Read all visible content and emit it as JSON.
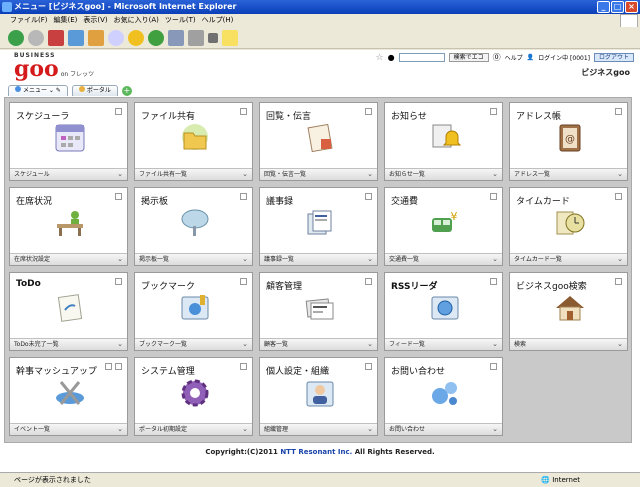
{
  "window": {
    "title": "メニュー [ビジネスgoo] - Microsoft Internet Explorer"
  },
  "menubar": [
    "ファイル(F)",
    "編集(E)",
    "表示(V)",
    "お気に入り(A)",
    "ツール(T)",
    "ヘルプ(H)"
  ],
  "header": {
    "logo_business": "BUSINESS",
    "logo_goo": "goo",
    "logo_sub": "on フレッツ",
    "search_button": "検索でエコ",
    "help": "ヘルプ",
    "login_status": "ログイン中 [0001]",
    "logout": "ログアウト",
    "site_title": "ビジネスgoo"
  },
  "tabs": [
    {
      "label": "メニュー"
    },
    {
      "label": "ポータル"
    }
  ],
  "tiles": [
    {
      "title": "スケジューラ",
      "link": "スケジュール"
    },
    {
      "title": "ファイル共有",
      "link": "ファイル共有一覧"
    },
    {
      "title": "回覧・伝言",
      "link": "回覧・伝言一覧"
    },
    {
      "title": "お知らせ",
      "link": "お知らせ一覧"
    },
    {
      "title": "アドレス帳",
      "link": "アドレス一覧"
    },
    {
      "title": "在席状況",
      "link": "在席状況設定"
    },
    {
      "title": "掲示板",
      "link": "掲示板一覧"
    },
    {
      "title": "議事録",
      "link": "議事録一覧"
    },
    {
      "title": "交通費",
      "link": "交通費一覧"
    },
    {
      "title": "タイムカード",
      "link": "タイムカード一覧"
    },
    {
      "title": "ToDo",
      "link": "ToDo未完了一覧"
    },
    {
      "title": "ブックマーク",
      "link": "ブックマーク一覧"
    },
    {
      "title": "顧客管理",
      "link": "顧客一覧"
    },
    {
      "title": "RSSリーダ",
      "link": "フィード一覧"
    },
    {
      "title": "ビジネスgoo検索",
      "link": "検索"
    },
    {
      "title": "幹事マッシュアップ",
      "link": "イベント一覧"
    },
    {
      "title": "システム管理",
      "link": "ポータル初期設定"
    },
    {
      "title": "個人設定・組織",
      "link": "組織管理"
    },
    {
      "title": "お問い合わせ",
      "link": "お問い合わせ"
    }
  ],
  "copyright": {
    "prefix": "Copyright:(C)2011 ",
    "company": "NTT Resonant Inc.",
    "suffix": " All Rights Reserved."
  },
  "status": {
    "text": "ページが表示されました",
    "zone": "Internet"
  },
  "colors": {
    "logo_red": "#d41a1a",
    "titlebar_blue": "#0a3fb8"
  }
}
